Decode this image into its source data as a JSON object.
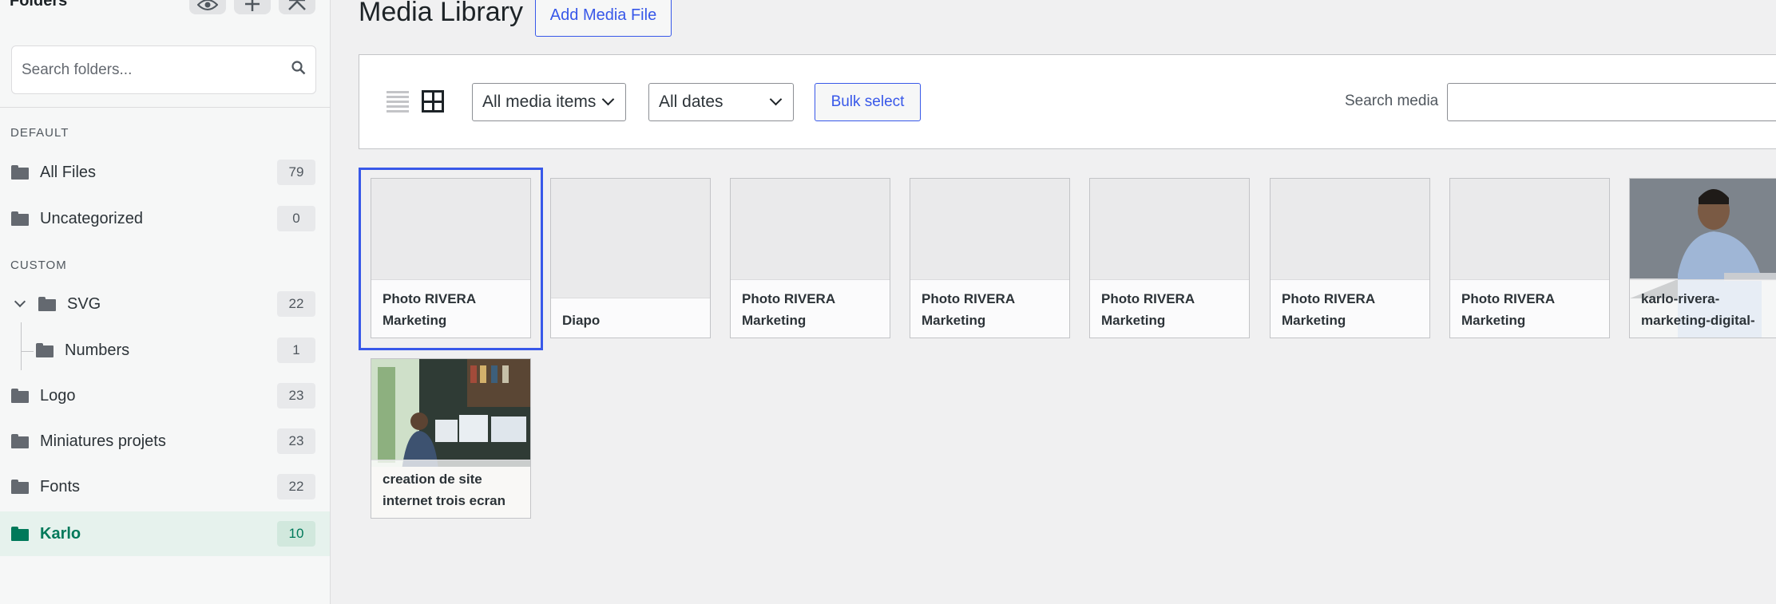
{
  "sidebar": {
    "title": "Folders",
    "search_placeholder": "Search folders...",
    "section_default": "DEFAULT",
    "section_custom": "CUSTOM",
    "folders": [
      {
        "label": "All Files",
        "count": "79"
      },
      {
        "label": "Uncategorized",
        "count": "0"
      },
      {
        "label": "SVG",
        "count": "22"
      },
      {
        "label": "Numbers",
        "count": "1"
      },
      {
        "label": "Logo",
        "count": "23"
      },
      {
        "label": "Miniatures projets",
        "count": "23"
      },
      {
        "label": "Fonts",
        "count": "22"
      },
      {
        "label": "Karlo",
        "count": "10"
      }
    ]
  },
  "header": {
    "title": "Media Library",
    "add_button": "Add Media File"
  },
  "toolbar": {
    "filter_type": "All media items",
    "filter_date": "All dates",
    "bulk_select": "Bulk select",
    "search_label": "Search media"
  },
  "media": [
    {
      "caption": "Photo RIVERA Marketing"
    },
    {
      "caption": "Diapo"
    },
    {
      "caption": "Photo RIVERA Marketing"
    },
    {
      "caption": "Photo RIVERA Marketing"
    },
    {
      "caption": "Photo RIVERA Marketing"
    },
    {
      "caption": "Photo RIVERA Marketing"
    },
    {
      "caption": "Photo RIVERA Marketing"
    },
    {
      "caption": "karlo-rivera-marketing-digital-"
    },
    {
      "caption": "creation de site internet trois ecran"
    }
  ],
  "colors": {
    "accent": "#3858e9",
    "active_folder": "#00795a",
    "active_folder_bg": "#e6f2ed"
  },
  "icons": [
    "eye-icon",
    "plus-icon",
    "collapse-icon",
    "search-icon",
    "folder-icon",
    "chevron-down-icon",
    "list-view-icon",
    "grid-view-icon"
  ]
}
